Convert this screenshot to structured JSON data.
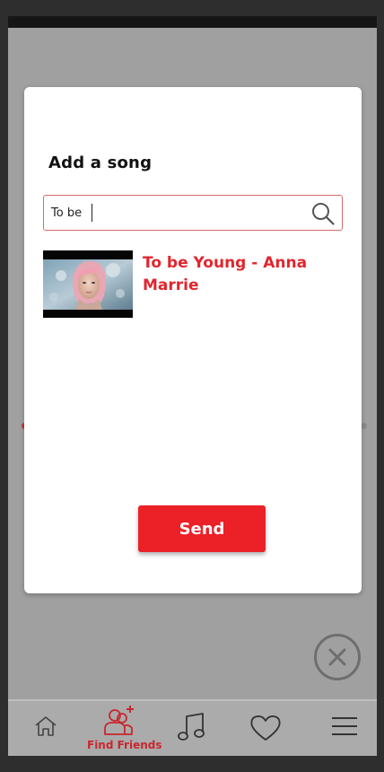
{
  "modal": {
    "title": "Add a song",
    "search_value": "To be",
    "result_title": "To be Young - Anna Marrie",
    "send_label": "Send"
  },
  "nav": {
    "items": [
      {
        "icon": "home-icon",
        "label": ""
      },
      {
        "icon": "find-friends-icon",
        "label": "Find Friends",
        "active": true
      },
      {
        "icon": "music-note-icon",
        "label": ""
      },
      {
        "icon": "heart-icon",
        "label": ""
      },
      {
        "icon": "menu-icon",
        "label": ""
      }
    ]
  },
  "colors": {
    "accent": "#ec2027",
    "accent_text": "#e0262f",
    "overlay": "#a0a0a0"
  }
}
